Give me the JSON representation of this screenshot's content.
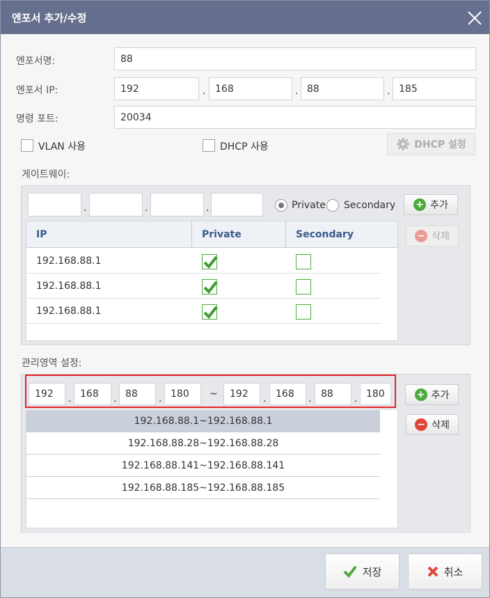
{
  "dialog": {
    "title": "엔포서 추가/수정"
  },
  "form": {
    "name_label": "엔포서명:",
    "name_value": "88",
    "ip_label": "엔포서 IP:",
    "ip": [
      "192",
      "168",
      "88",
      "185"
    ],
    "port_label": "명령 포트:",
    "port_value": "20034",
    "vlan_label": "VLAN 사용",
    "dhcp_label": "DHCP 사용",
    "dhcp_settings_button": "DHCP 설정"
  },
  "gateway": {
    "label": "게이트웨이:",
    "ip": [
      "",
      "",
      "",
      ""
    ],
    "radio_private": "Private",
    "radio_secondary": "Secondary",
    "add_button": "추가",
    "delete_button": "삭제",
    "columns": [
      "IP",
      "Private",
      "Secondary"
    ],
    "rows": [
      {
        "ip": "192.168.88.1",
        "private": true,
        "secondary": false
      },
      {
        "ip": "192.168.88.1",
        "private": true,
        "secondary": false
      },
      {
        "ip": "192.168.88.1",
        "private": true,
        "secondary": false
      }
    ]
  },
  "range": {
    "label": "관리영역 설정:",
    "start": [
      "192",
      "168",
      "88",
      "180"
    ],
    "separator": "~",
    "end": [
      "192",
      "168",
      "88",
      "180"
    ],
    "add_button": "추가",
    "delete_button": "삭제",
    "rows": [
      "192.168.88.1~192.168.88.1",
      "192.168.88.28~192.168.88.28",
      "192.168.88.141~192.168.88.141",
      "192.168.88.185~192.168.88.185"
    ]
  },
  "footer": {
    "save_button": "저장",
    "cancel_button": "취소"
  },
  "colors": {
    "titlebar": "#66708e",
    "accent_green": "#4caa3c",
    "accent_red": "#e0453a",
    "highlight": "#e8202a"
  }
}
